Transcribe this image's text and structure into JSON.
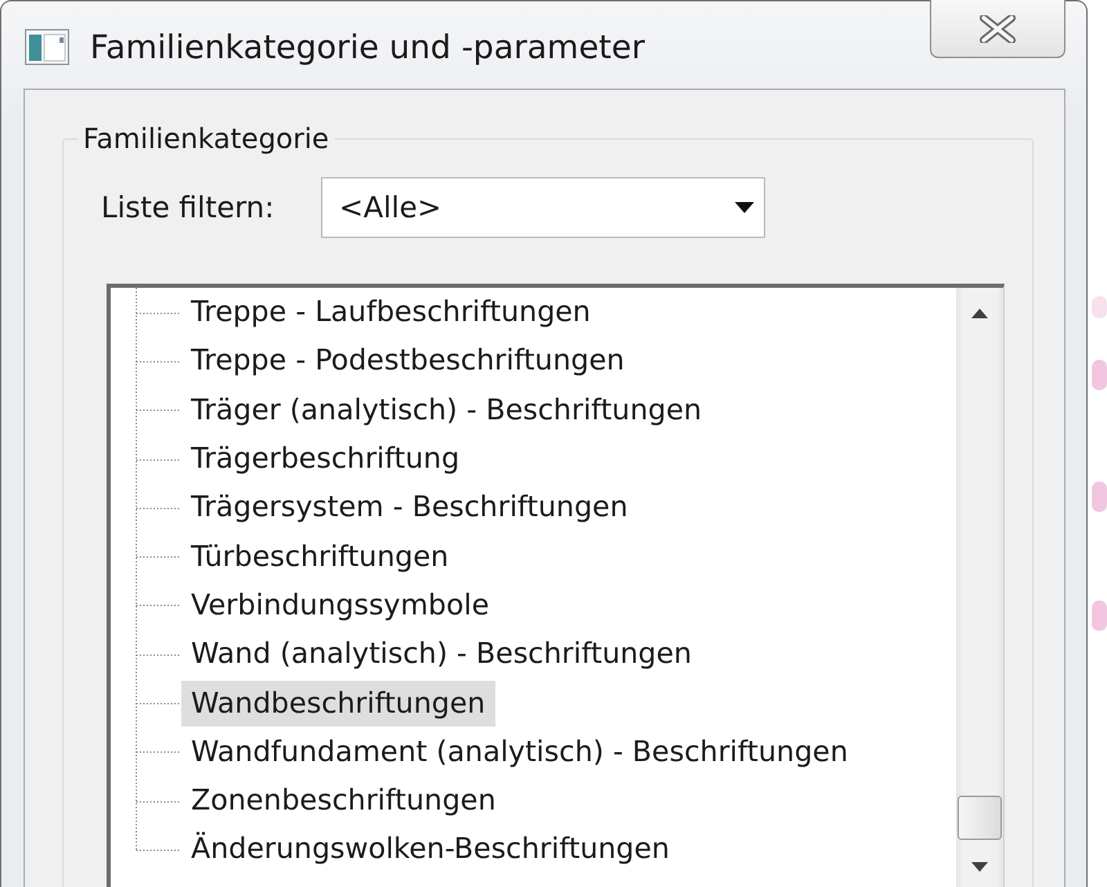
{
  "window": {
    "title": "Familienkategorie und -parameter"
  },
  "family_category": {
    "title": "Familienkategorie",
    "filter": {
      "label": "Liste filtern:",
      "value": "<Alle>"
    },
    "category_list": {
      "items": [
        {
          "label": "Treppe - Laufbeschriftungen",
          "selected": false
        },
        {
          "label": "Treppe - Podestbeschriftungen",
          "selected": false
        },
        {
          "label": "Träger (analytisch) - Beschriftungen",
          "selected": false
        },
        {
          "label": "Trägerbeschriftung",
          "selected": false
        },
        {
          "label": "Trägersystem - Beschriftungen",
          "selected": false
        },
        {
          "label": "Türbeschriftungen",
          "selected": false
        },
        {
          "label": "Verbindungssymbole",
          "selected": false
        },
        {
          "label": "Wand (analytisch) - Beschriftungen",
          "selected": false
        },
        {
          "label": "Wandbeschriftungen",
          "selected": true
        },
        {
          "label": "Wandfundament (analytisch) - Beschriftungen",
          "selected": false
        },
        {
          "label": "Zonenbeschriftungen",
          "selected": false
        },
        {
          "label": "Änderungswolken-Beschriftungen",
          "selected": false
        }
      ]
    }
  }
}
